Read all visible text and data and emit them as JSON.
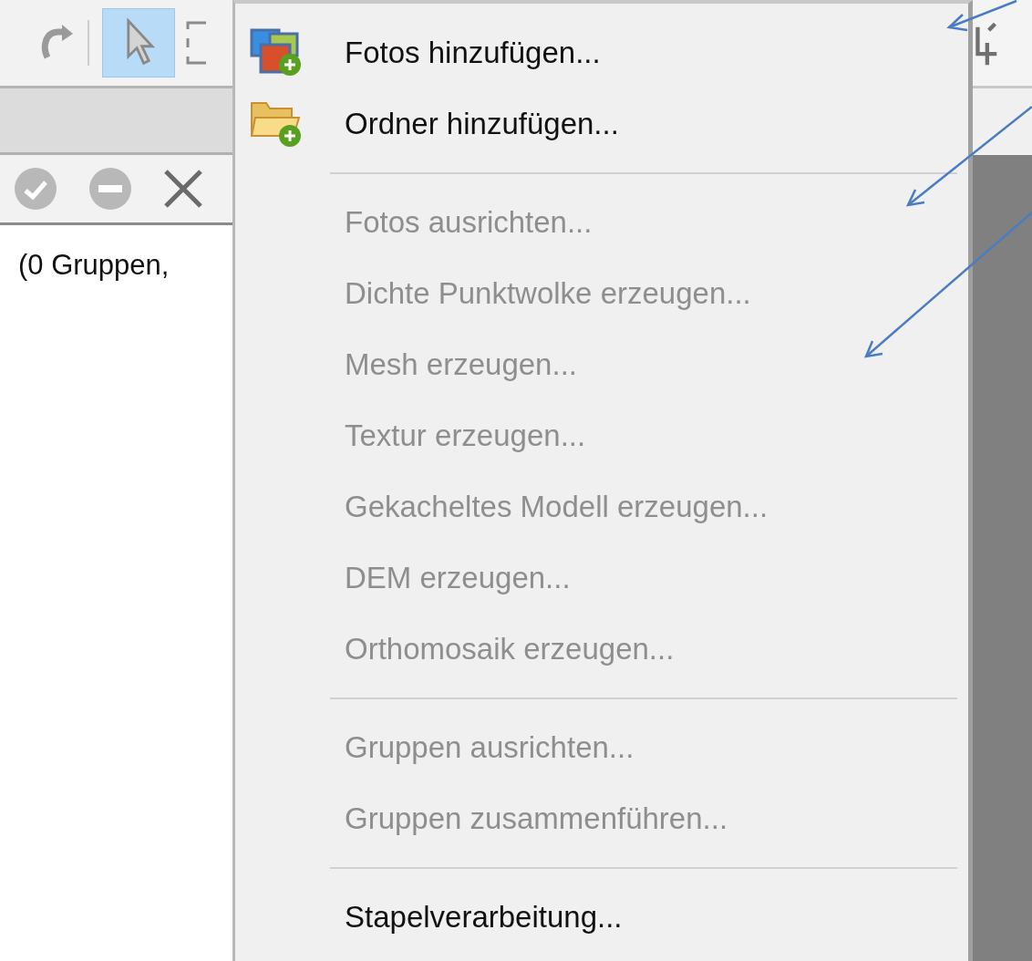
{
  "status_text": "(0 Gruppen,",
  "toolbar": {
    "pointer_tool": {
      "selected": true
    }
  },
  "menu": {
    "items": [
      {
        "kind": "item",
        "label": "Fotos hinzufügen...",
        "disabled": false
      },
      {
        "kind": "item",
        "label": "Ordner hinzufügen...",
        "disabled": false
      },
      {
        "kind": "separator"
      },
      {
        "kind": "item",
        "label": "Fotos ausrichten...",
        "disabled": true
      },
      {
        "kind": "item",
        "label": "Dichte Punktwolke erzeugen...",
        "disabled": true
      },
      {
        "kind": "item",
        "label": "Mesh erzeugen...",
        "disabled": true
      },
      {
        "kind": "item",
        "label": "Textur erzeugen...",
        "disabled": true
      },
      {
        "kind": "item",
        "label": "Gekacheltes Modell erzeugen...",
        "disabled": true
      },
      {
        "kind": "item",
        "label": "DEM erzeugen...",
        "disabled": true
      },
      {
        "kind": "item",
        "label": "Orthomosaik erzeugen...",
        "disabled": true
      },
      {
        "kind": "separator"
      },
      {
        "kind": "item",
        "label": "Gruppen ausrichten...",
        "disabled": true
      },
      {
        "kind": "item",
        "label": "Gruppen zusammenführen...",
        "disabled": true
      },
      {
        "kind": "separator"
      },
      {
        "kind": "item",
        "label": "Stapelverarbeitung...",
        "disabled": false
      }
    ]
  }
}
